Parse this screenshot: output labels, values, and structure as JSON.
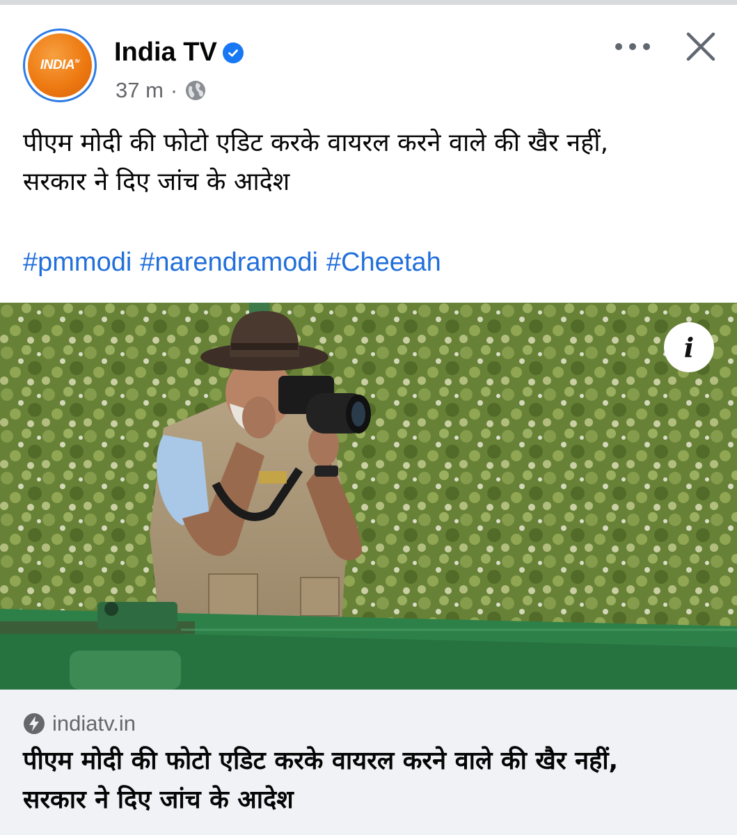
{
  "post": {
    "page_name": "India TV",
    "avatar_logo_text": "INDIA",
    "avatar_logo_sup": "tv",
    "time": "37 m",
    "separator": "·",
    "audience_icon": "globe-icon",
    "verified_icon": "verified-badge-icon",
    "more_icon": "more-horizontal-icon",
    "close_icon": "close-icon",
    "text_line1": "पीएम मोदी की फोटो एडिट करके वायरल करने वाले की खैर नहीं,",
    "text_line2": "सरकार ने दिए जांच के आदेश",
    "hashtags": [
      "#pmmodi",
      "#narendramodi",
      "#Cheetah"
    ]
  },
  "photo": {
    "info_label": "i"
  },
  "link_preview": {
    "domain": "indiatv.in",
    "domain_icon": "bolt-icon",
    "title_line1": "पीएम मोदी की फोटो एडिट करके वायरल करने वाले की खैर नहीं,",
    "title_line2": "सरकार ने दिए जांच के आदेश"
  },
  "colors": {
    "accent_blue": "#1877f2",
    "hashtag_blue": "#216fdb",
    "logo_orange": "#ee7a12",
    "muted_text": "#65676b",
    "card_bg": "#f0f2f5"
  }
}
